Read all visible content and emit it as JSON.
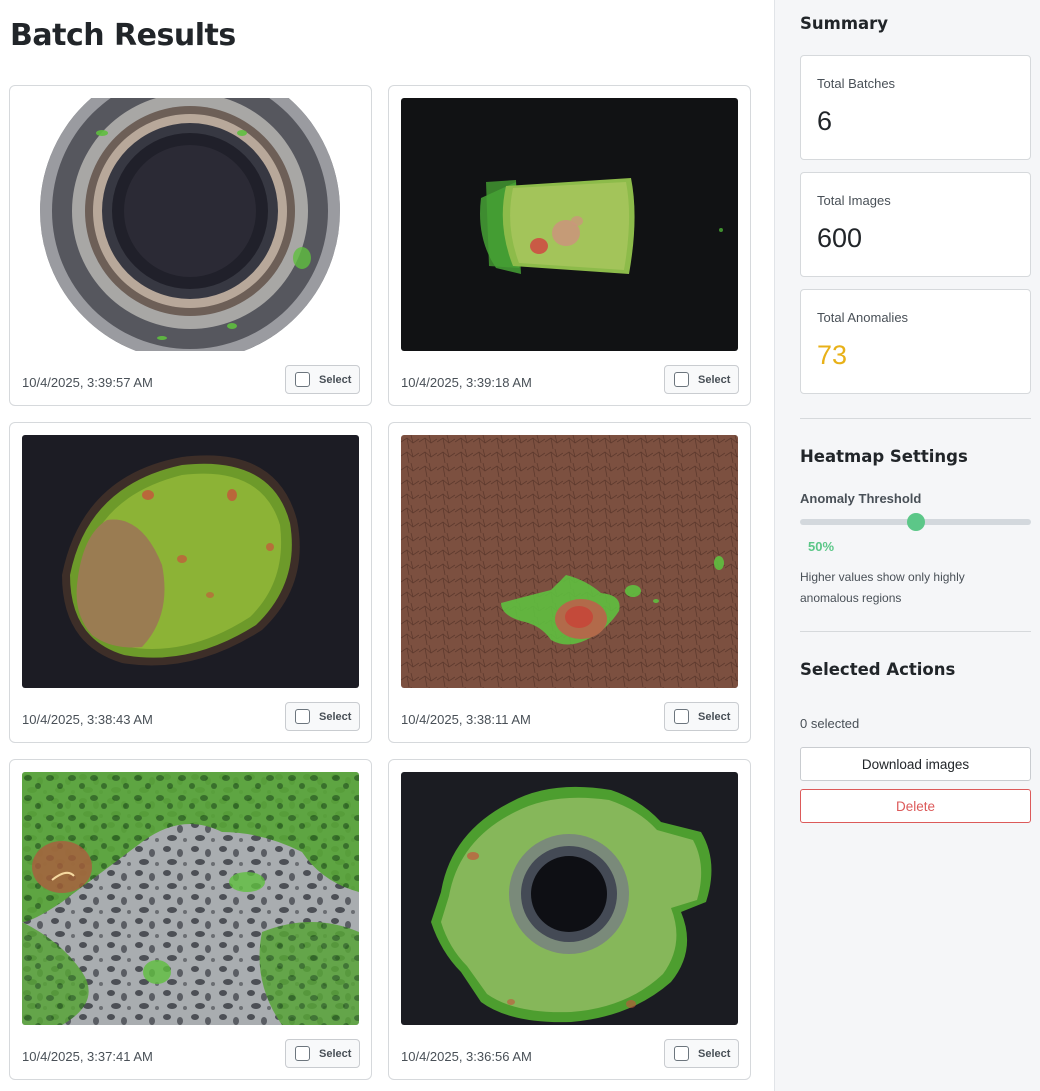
{
  "page": {
    "title": "Batch Results"
  },
  "results": [
    {
      "timestamp": "10/4/2025, 3:39:57 AM",
      "select_label": "Select",
      "image": "bottle-heatmap"
    },
    {
      "timestamp": "10/4/2025, 3:39:18 AM",
      "select_label": "Select",
      "image": "cable-piece-heatmap"
    },
    {
      "timestamp": "10/4/2025, 3:38:43 AM",
      "select_label": "Select",
      "image": "hazelnut-heatmap"
    },
    {
      "timestamp": "10/4/2025, 3:38:11 AM",
      "select_label": "Select",
      "image": "leather-heatmap"
    },
    {
      "timestamp": "10/4/2025, 3:37:41 AM",
      "select_label": "Select",
      "image": "tile-heatmap"
    },
    {
      "timestamp": "10/4/2025, 3:36:56 AM",
      "select_label": "Select",
      "image": "metal-nut-heatmap"
    }
  ],
  "sidebar": {
    "summary_title": "Summary",
    "stats": [
      {
        "label": "Total Batches",
        "value": "6"
      },
      {
        "label": "Total Images",
        "value": "600"
      },
      {
        "label": "Total Anomalies",
        "value": "73"
      }
    ],
    "heatmap": {
      "title": "Heatmap Settings",
      "threshold_label": "Anomaly Threshold",
      "threshold_percent": 50,
      "threshold_text": "50%",
      "hint": "Higher values show only highly anomalous regions"
    },
    "actions": {
      "title": "Selected Actions",
      "selected_count": "0 selected",
      "download_label": "Download images",
      "delete_label": "Delete"
    }
  },
  "colors": {
    "accent": "#5cc788",
    "warning": "#e8b118",
    "danger": "#dc5a5a"
  }
}
